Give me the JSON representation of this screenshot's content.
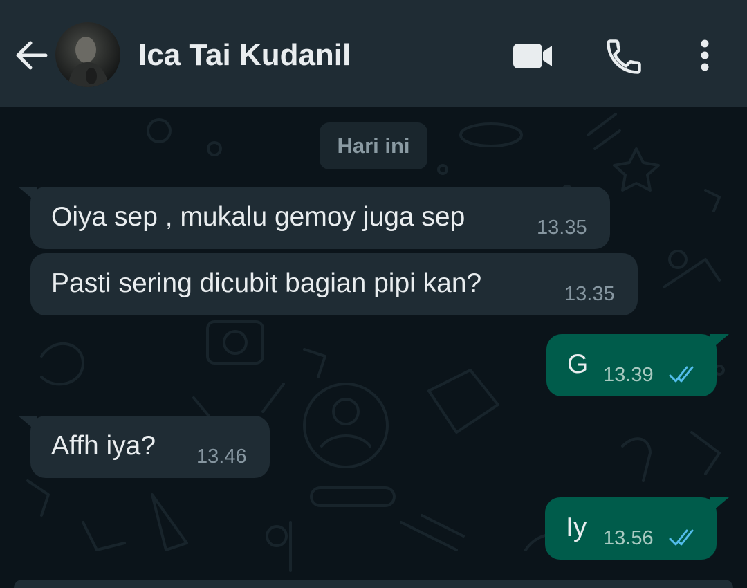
{
  "header": {
    "contact_name": "Ica Tai Kudanil"
  },
  "chat": {
    "date_label": "Hari ini",
    "messages": [
      {
        "direction": "incoming",
        "text": "Oiya sep , mukalu gemoy juga sep",
        "time": "13.35"
      },
      {
        "direction": "incoming",
        "text": "Pasti sering dicubit bagian pipi kan?",
        "time": "13.35"
      },
      {
        "direction": "outgoing",
        "text": "G",
        "time": "13.39",
        "status": "read"
      },
      {
        "direction": "incoming",
        "text": "Affh iya?",
        "time": "13.46"
      },
      {
        "direction": "outgoing",
        "text": "Iy",
        "time": "13.56",
        "status": "read"
      }
    ]
  },
  "icons": {
    "back": "arrow-left-icon",
    "video": "video-camera-icon",
    "call": "phone-icon",
    "menu": "more-vertical-icon",
    "read_receipt": "double-check-icon"
  },
  "colors": {
    "header_bg": "#1f2c34",
    "chat_bg": "#0b141a",
    "incoming_bubble": "#1f2c34",
    "outgoing_bubble": "#005c4b",
    "read_tick": "#53bdeb"
  }
}
